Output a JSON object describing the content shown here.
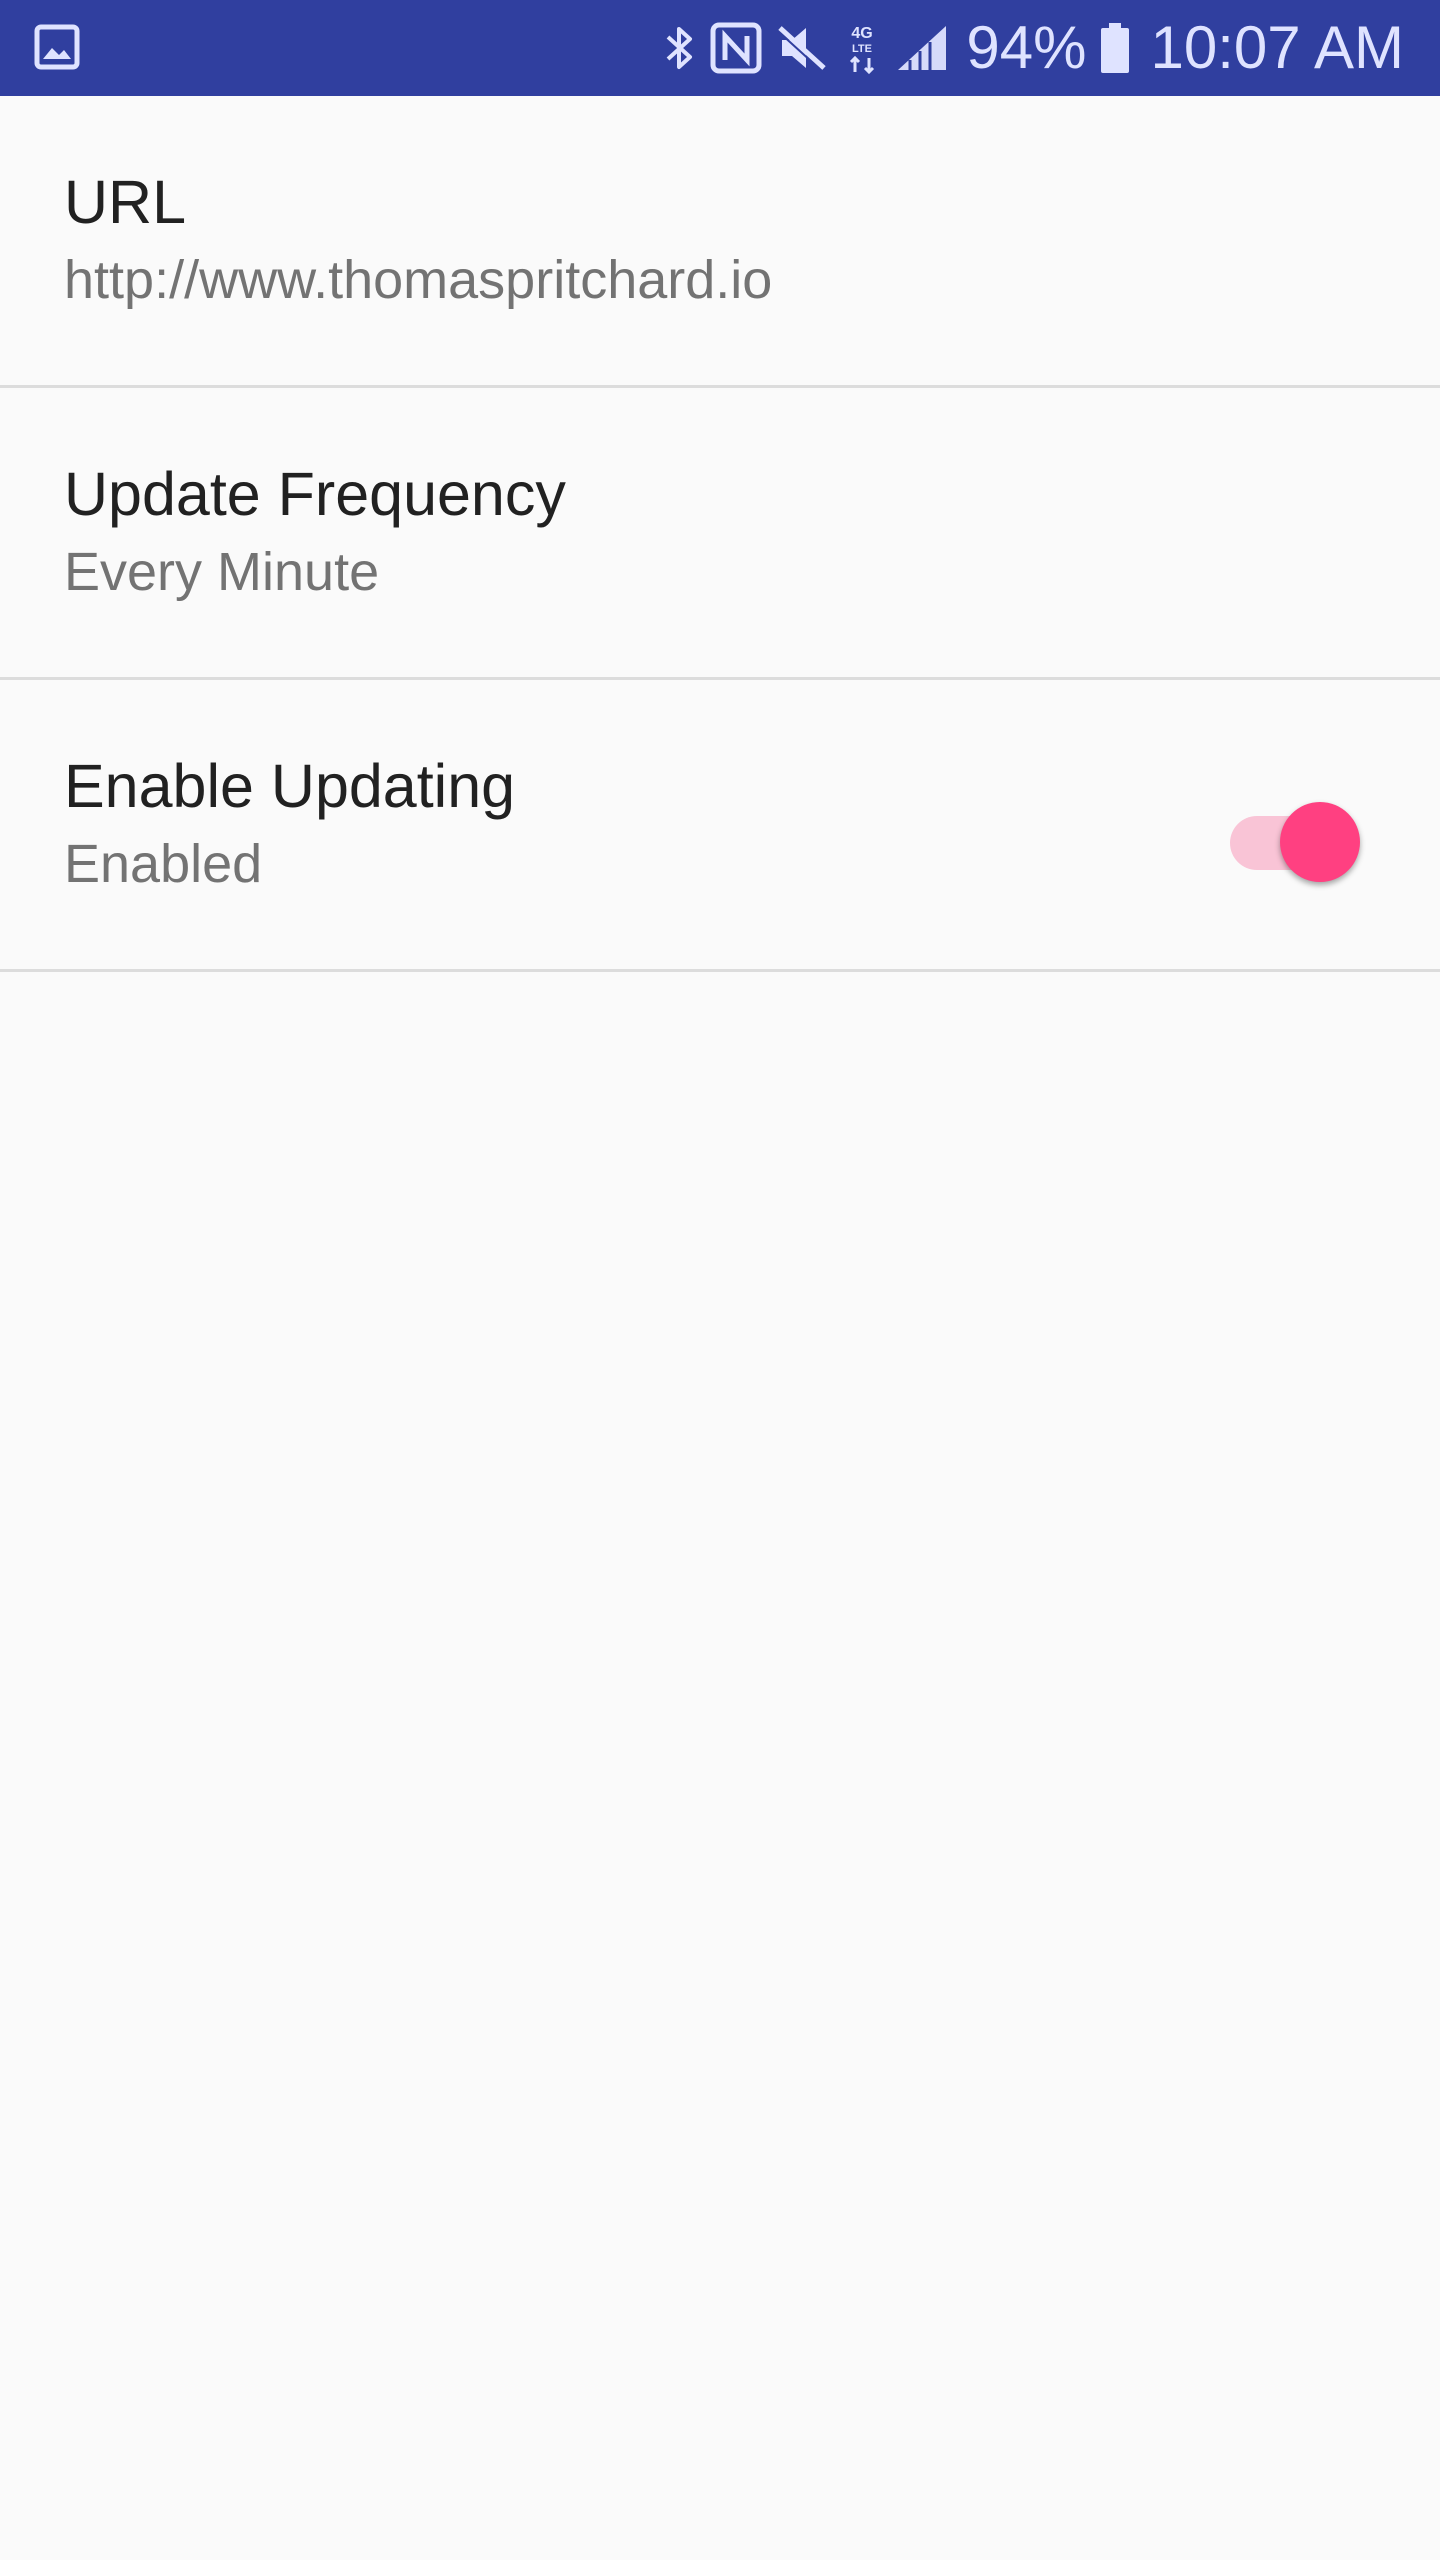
{
  "status_bar": {
    "background_color": "#303f9f",
    "left_icon": "gallery-notification-icon",
    "icons": [
      "bluetooth-icon",
      "nfc-icon",
      "mute-icon",
      "lte-4g-icon",
      "signal-icon"
    ],
    "battery_percent": "94%",
    "battery_icon": "battery-icon",
    "time": "10:07 AM"
  },
  "preferences": [
    {
      "title": "URL",
      "summary": "http://www.thomaspritchard.io"
    },
    {
      "title": "Update Frequency",
      "summary": "Every Minute"
    },
    {
      "title": "Enable Updating",
      "summary": "Enabled",
      "toggle_on": true,
      "accent_color": "#ff4081"
    }
  ]
}
